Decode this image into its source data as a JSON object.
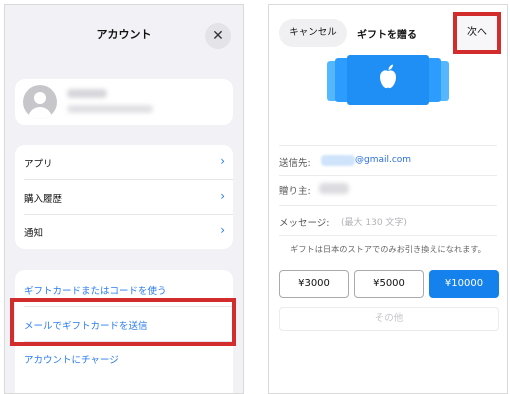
{
  "left": {
    "title": "アカウント",
    "close_symbol": "✕",
    "menu": [
      {
        "label": "アプリ",
        "chevron": "›"
      },
      {
        "label": "購入履歴",
        "chevron": "›"
      },
      {
        "label": "通知",
        "chevron": "›"
      }
    ],
    "links": [
      {
        "label": "ギフトカードまたはコードを使う"
      },
      {
        "label": "メールでギフトカードを送信"
      },
      {
        "label": "アカウントにチャージ"
      }
    ],
    "highlighted_link_index": 1
  },
  "right": {
    "cancel_label": "キャンセル",
    "title": "ギフトを贈る",
    "next_label": "次へ",
    "to_label": "送信先:",
    "email_domain": "@gmail.com",
    "from_label": "贈り主:",
    "message_label": "メッセージ:",
    "message_placeholder": "(最大 130 文字)",
    "note": "ギフトは日本のストアでのみお引き換えになれます。",
    "amounts": [
      {
        "label": "¥3000",
        "selected": false
      },
      {
        "label": "¥5000",
        "selected": false
      },
      {
        "label": "¥10000",
        "selected": true
      }
    ],
    "other_label": "その他"
  },
  "colors": {
    "accent": "#2a7cf2",
    "highlight": "#d32c2c",
    "selected_amount": "#1581ec",
    "panel_background": "#f2f2f6"
  }
}
